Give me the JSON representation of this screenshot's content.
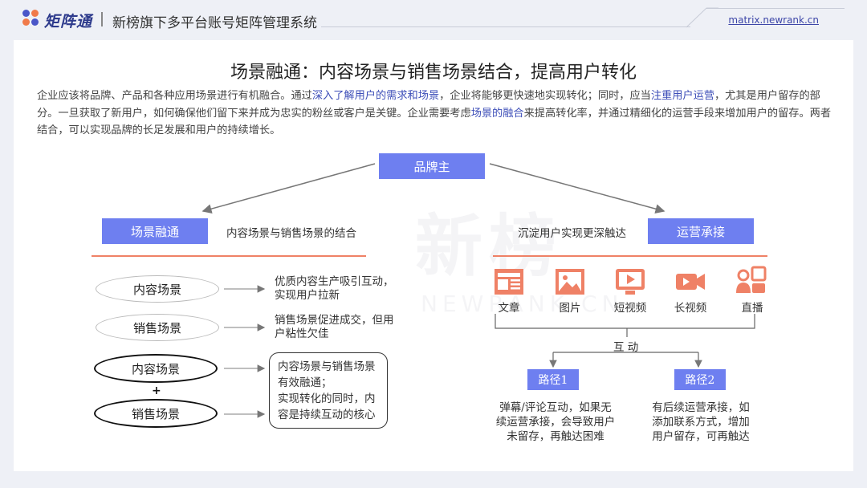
{
  "header": {
    "brand": "矩阵通",
    "subtitle": "新榜旗下多平台账号矩阵管理系统",
    "url": "matrix.newrank.cn"
  },
  "watermark": {
    "big": "新榜",
    "small": "NEWRANK.CN"
  },
  "title": "场景融通：内容场景与销售场景结合，提高用户转化",
  "intro": {
    "p1": "企业应该将品牌、产品和各种应用场景进行有机融合。通过",
    "h1": "深入了解用户的需求和场景",
    "p2": "，企业将能够更快速地实现转化；同时，应当",
    "h2": "注重用户运营",
    "p3": "，尤其是用户留存的部分。一旦获取了新用户，如何确保他们留下来并成为忠实的粉丝或客户是关键。企业需要考虑",
    "h3": "场景的融合",
    "p4": "来提高转化率，并通过精细化的运营手段来增加用户的留存。两者结合，可以实现品牌的长足发展和用户的持续增长。"
  },
  "root": "品牌主",
  "left": {
    "heading": "场景融通",
    "caption": "内容场景与销售场景的结合",
    "rows": [
      {
        "label": "内容场景",
        "desc": "优质内容生产吸引互动，实现用户拉新"
      },
      {
        "label": "销售场景",
        "desc": "销售场景促进成交，但用户粘性欠佳"
      }
    ],
    "combo": {
      "top": "内容场景",
      "plus": "+",
      "bottom": "销售场景",
      "desc_l1": "内容场景与销售场景",
      "desc_l2": "有效融通；",
      "desc_l3": "实现转化的同时，内",
      "desc_l4": "容是持续互动的核心"
    }
  },
  "right": {
    "heading": "运营承接",
    "caption": "沉淀用户实现更深触达",
    "channels": [
      {
        "label": "文章",
        "icon": "article-icon"
      },
      {
        "label": "图片",
        "icon": "image-icon"
      },
      {
        "label": "短视频",
        "icon": "short-video-icon"
      },
      {
        "label": "长视频",
        "icon": "long-video-icon"
      },
      {
        "label": "直播",
        "icon": "live-stream-icon"
      }
    ],
    "interaction": "互 动",
    "paths": [
      {
        "label": "路径1",
        "desc_l1": "弹幕/评论互动，如果无",
        "desc_l2": "续运营承接，会导致用户",
        "desc_l3": "未留存，再触达困难"
      },
      {
        "label": "路径2",
        "desc_l1": "有后续运营承接，如",
        "desc_l2": "添加联系方式，增加",
        "desc_l3": "用户留存，可再触达"
      }
    ]
  },
  "colors": {
    "accent": "#6e7ff0",
    "orange": "#ef8166",
    "brand": "#2d3a8c"
  }
}
